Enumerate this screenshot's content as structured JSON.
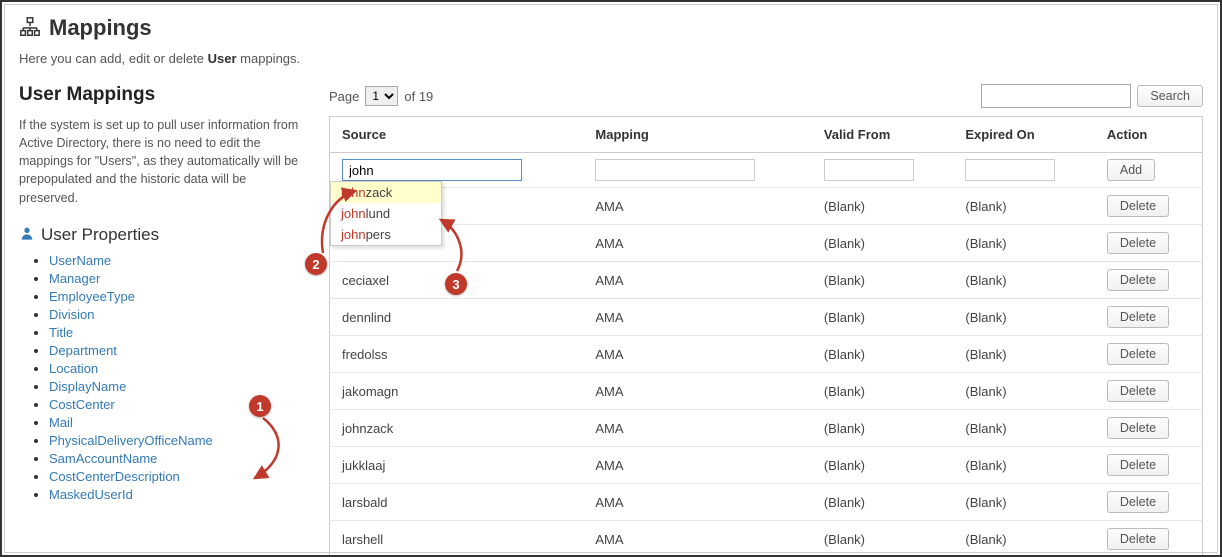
{
  "header": {
    "title": "Mappings",
    "description_pre": "Here you can add, edit or delete ",
    "description_bold": "User",
    "description_post": " mappings."
  },
  "sidebar": {
    "title": "User Mappings",
    "explanation": "If the system is set up to pull user information from Active Directory, there is no need to edit the mappings for \"Users\", as they automatically will be prepopulated and the historic data will be preserved.",
    "props_title": "User Properties",
    "properties": [
      "UserName",
      "Manager",
      "EmployeeType",
      "Division",
      "Title",
      "Department",
      "Location",
      "DisplayName",
      "CostCenter",
      "Mail",
      "PhysicalDeliveryOfficeName",
      "SamAccountName",
      "CostCenterDescription",
      "MaskedUserId"
    ]
  },
  "pager": {
    "label_page": "Page",
    "current": "1",
    "of": "of 19"
  },
  "search": {
    "button": "Search"
  },
  "table": {
    "columns": [
      "Source",
      "Mapping",
      "Valid From",
      "Expired On",
      "Action"
    ],
    "add_label": "Add",
    "delete_label": "Delete",
    "filter_source_value": "john",
    "rows": [
      {
        "source": "",
        "mapping": "AMA",
        "valid_from": "(Blank)",
        "expired_on": "(Blank)"
      },
      {
        "source": "",
        "mapping": "AMA",
        "valid_from": "(Blank)",
        "expired_on": "(Blank)"
      },
      {
        "source": "ceciaxel",
        "mapping": "AMA",
        "valid_from": "(Blank)",
        "expired_on": "(Blank)"
      },
      {
        "source": "dennlind",
        "mapping": "AMA",
        "valid_from": "(Blank)",
        "expired_on": "(Blank)"
      },
      {
        "source": "fredolss",
        "mapping": "AMA",
        "valid_from": "(Blank)",
        "expired_on": "(Blank)"
      },
      {
        "source": "jakomagn",
        "mapping": "AMA",
        "valid_from": "(Blank)",
        "expired_on": "(Blank)"
      },
      {
        "source": "johnzack",
        "mapping": "AMA",
        "valid_from": "(Blank)",
        "expired_on": "(Blank)"
      },
      {
        "source": "jukklaaj",
        "mapping": "AMA",
        "valid_from": "(Blank)",
        "expired_on": "(Blank)"
      },
      {
        "source": "larsbald",
        "mapping": "AMA",
        "valid_from": "(Blank)",
        "expired_on": "(Blank)"
      },
      {
        "source": "larshell",
        "mapping": "AMA",
        "valid_from": "(Blank)",
        "expired_on": "(Blank)"
      }
    ]
  },
  "autocomplete": {
    "query": "john",
    "items": [
      {
        "match": "john",
        "rest": "zack",
        "selected": true
      },
      {
        "match": "john",
        "rest": "lund",
        "selected": false
      },
      {
        "match": "john",
        "rest": "pers",
        "selected": false
      }
    ]
  },
  "callouts": {
    "c1": "1",
    "c2": "2",
    "c3": "3"
  }
}
